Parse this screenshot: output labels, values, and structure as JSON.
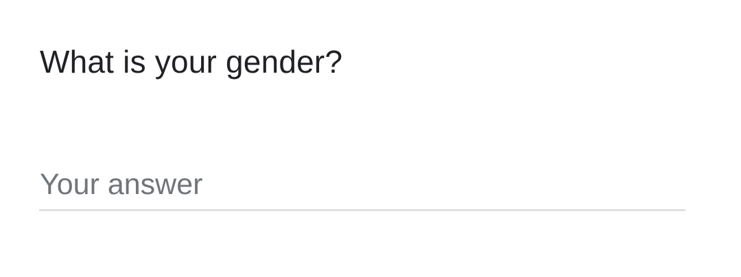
{
  "question": {
    "title": "What is your gender?"
  },
  "answer": {
    "placeholder": "Your answer",
    "value": ""
  },
  "colors": {
    "title_text": "#202124",
    "placeholder_text": "#70757a",
    "underline": "#e0e0e0",
    "background": "#ffffff"
  }
}
